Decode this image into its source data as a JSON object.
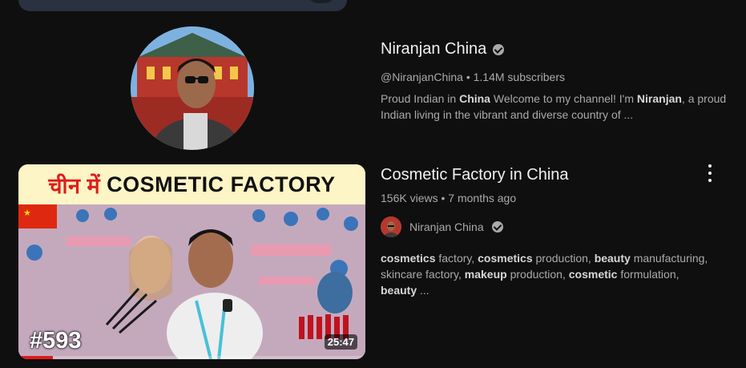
{
  "channel": {
    "name": "Niranjan China",
    "handle": "@NiranjanChina",
    "subscribers": "1.14M subscribers",
    "description_parts": [
      {
        "text": "Proud Indian in ",
        "bold": false
      },
      {
        "text": "China",
        "bold": true
      },
      {
        "text": " Welcome to my channel! I'm ",
        "bold": false
      },
      {
        "text": "Niranjan",
        "bold": true
      },
      {
        "text": ", a proud Indian living in the vibrant and diverse country of ...",
        "bold": false
      }
    ]
  },
  "video": {
    "thumbnail_banner_hindi": "चीन में",
    "thumbnail_banner_english": "COSMETIC FACTORY",
    "episode_label": "#593",
    "duration": "25:47",
    "watch_progress": 0.1,
    "title": "Cosmetic Factory in China",
    "views": "156K views",
    "age": "7 months ago",
    "channel_name": "Niranjan China",
    "description_parts": [
      {
        "text": "cosmetics",
        "bold": true
      },
      {
        "text": " factory, ",
        "bold": false
      },
      {
        "text": "cosmetics",
        "bold": true
      },
      {
        "text": " production, ",
        "bold": false
      },
      {
        "text": "beauty",
        "bold": true
      },
      {
        "text": " manufacturing, skincare factory, ",
        "bold": false
      },
      {
        "text": "makeup",
        "bold": true
      },
      {
        "text": " production, ",
        "bold": false
      },
      {
        "text": "cosmetic",
        "bold": true
      },
      {
        "text": " formulation, ",
        "bold": false
      },
      {
        "text": "beauty",
        "bold": true
      },
      {
        "text": " ...",
        "bold": false
      }
    ]
  },
  "icons": {
    "verified": "verified-check-icon",
    "more": "more-vert-icon"
  },
  "colors": {
    "background": "#0f0f0f",
    "primary_text": "#f1f1f1",
    "secondary_text": "#aaaaaa",
    "progress": "#e01b1b"
  }
}
